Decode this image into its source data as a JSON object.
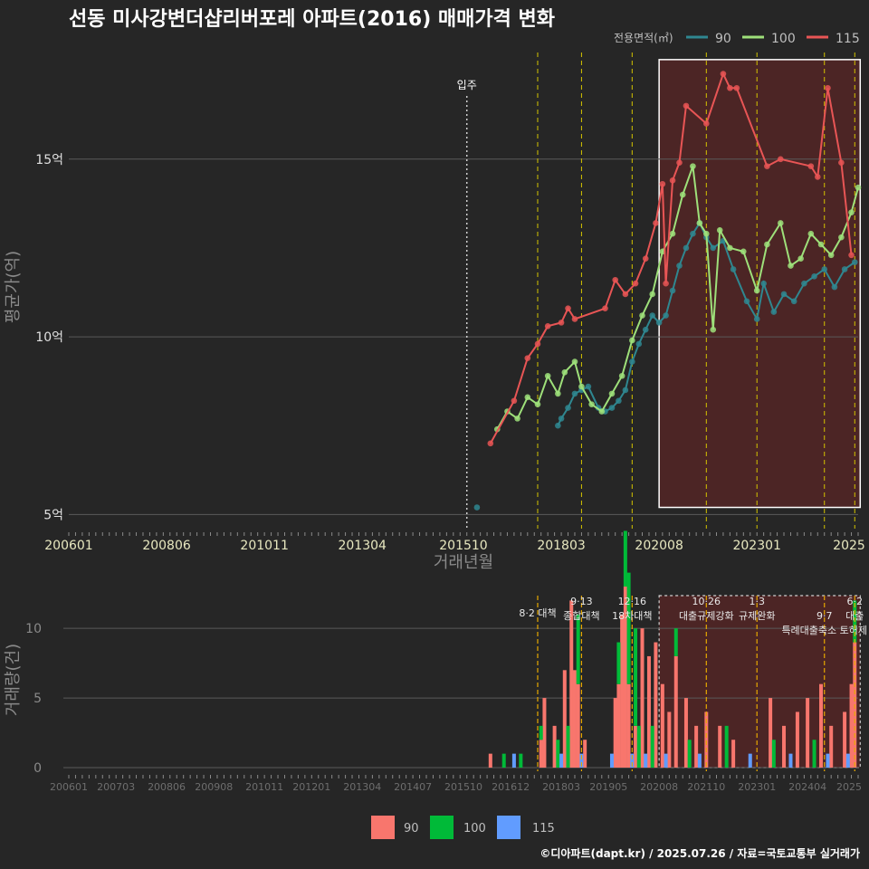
{
  "title": "선동 미사강변더샵리버포레 아파트(2016) 매매가격 변화",
  "legend_top": {
    "title": "전용면적(㎡)",
    "items": [
      "90",
      "100",
      "115"
    ]
  },
  "legend_bottom": {
    "items": [
      "90",
      "100",
      "115"
    ]
  },
  "footer": "©디아파트(dapt.kr) / 2025.07.26 / 자료=국토교통부 실거래가",
  "colors": {
    "background": "#262626",
    "price_90": "#2f8790",
    "price_100": "#9ee07a",
    "price_115": "#e85555",
    "vol_90": "#f8766d",
    "vol_100": "#00ba38",
    "vol_115": "#619cff",
    "policy_line": "#d4c400",
    "highlight_fill": "#5a2626"
  },
  "chart_data": [
    {
      "type": "line",
      "title": "선동 미사강변더샵리버포레 아파트(2016) 매매가격 변화",
      "xlabel": "거래년월",
      "ylabel": "평균가(억)",
      "x_ticks": [
        "200601",
        "200806",
        "201011",
        "201304",
        "201510",
        "201803",
        "202008",
        "202301",
        "2025"
      ],
      "y_ticks": [
        "5억",
        "10억",
        "15억"
      ],
      "ylim": [
        4.5,
        18
      ],
      "grid": true,
      "legend": "top-right",
      "annotation": "입주",
      "annotation_x": "2015-11",
      "policy_dates": [
        "2017-08",
        "2018-09",
        "2019-12",
        "2021-10",
        "2023-01",
        "2024-09",
        "2025-06"
      ],
      "highlight_range": [
        "2020-08",
        "2025-06"
      ],
      "series": [
        {
          "name": "90",
          "points": [
            [
              "2016-02",
              5.2
            ],
            [
              "2018-02",
              7.5
            ],
            [
              "2018-03",
              7.7
            ],
            [
              "2018-05",
              8.0
            ],
            [
              "2018-07",
              8.4
            ],
            [
              "2018-09",
              8.5
            ],
            [
              "2018-11",
              8.6
            ],
            [
              "2019-02",
              8.0
            ],
            [
              "2019-04",
              7.9
            ],
            [
              "2019-06",
              8.0
            ],
            [
              "2019-08",
              8.2
            ],
            [
              "2019-10",
              8.5
            ],
            [
              "2019-12",
              9.3
            ],
            [
              "2020-02",
              9.8
            ],
            [
              "2020-04",
              10.2
            ],
            [
              "2020-06",
              10.6
            ],
            [
              "2020-08",
              10.4
            ],
            [
              "2020-10",
              10.6
            ],
            [
              "2020-12",
              11.3
            ],
            [
              "2021-02",
              12.0
            ],
            [
              "2021-04",
              12.5
            ],
            [
              "2021-06",
              12.9
            ],
            [
              "2021-08",
              13.2
            ],
            [
              "2021-10",
              12.8
            ],
            [
              "2021-12",
              12.5
            ],
            [
              "2022-03",
              12.7
            ],
            [
              "2022-06",
              11.9
            ],
            [
              "2022-10",
              11.0
            ],
            [
              "2023-01",
              10.5
            ],
            [
              "2023-03",
              11.5
            ],
            [
              "2023-06",
              10.7
            ],
            [
              "2023-09",
              11.2
            ],
            [
              "2023-12",
              11.0
            ],
            [
              "2024-03",
              11.5
            ],
            [
              "2024-06",
              11.7
            ],
            [
              "2024-09",
              11.9
            ],
            [
              "2024-12",
              11.4
            ],
            [
              "2025-03",
              11.9
            ],
            [
              "2025-06",
              12.1
            ]
          ]
        },
        {
          "name": "100",
          "points": [
            [
              "2016-08",
              7.4
            ],
            [
              "2016-11",
              7.9
            ],
            [
              "2017-02",
              7.7
            ],
            [
              "2017-05",
              8.3
            ],
            [
              "2017-08",
              8.1
            ],
            [
              "2017-11",
              8.9
            ],
            [
              "2018-02",
              8.4
            ],
            [
              "2018-04",
              9.0
            ],
            [
              "2018-07",
              9.3
            ],
            [
              "2018-09",
              8.6
            ],
            [
              "2018-12",
              8.1
            ],
            [
              "2019-03",
              7.9
            ],
            [
              "2019-06",
              8.4
            ],
            [
              "2019-09",
              8.9
            ],
            [
              "2019-12",
              9.9
            ],
            [
              "2020-03",
              10.6
            ],
            [
              "2020-06",
              11.2
            ],
            [
              "2020-09",
              12.4
            ],
            [
              "2020-12",
              12.9
            ],
            [
              "2021-03",
              14.0
            ],
            [
              "2021-06",
              14.8
            ],
            [
              "2021-08",
              13.2
            ],
            [
              "2021-10",
              12.9
            ],
            [
              "2021-12",
              10.2
            ],
            [
              "2022-02",
              13.0
            ],
            [
              "2022-05",
              12.5
            ],
            [
              "2022-09",
              12.4
            ],
            [
              "2023-01",
              11.3
            ],
            [
              "2023-04",
              12.6
            ],
            [
              "2023-08",
              13.2
            ],
            [
              "2023-11",
              12.0
            ],
            [
              "2024-02",
              12.2
            ],
            [
              "2024-05",
              12.9
            ],
            [
              "2024-08",
              12.6
            ],
            [
              "2024-11",
              12.3
            ],
            [
              "2025-02",
              12.8
            ],
            [
              "2025-05",
              13.5
            ],
            [
              "2025-07",
              14.2
            ]
          ]
        },
        {
          "name": "115",
          "points": [
            [
              "2016-06",
              7.0
            ],
            [
              "2017-01",
              8.2
            ],
            [
              "2017-05",
              9.4
            ],
            [
              "2017-08",
              9.8
            ],
            [
              "2017-11",
              10.3
            ],
            [
              "2018-03",
              10.4
            ],
            [
              "2018-05",
              10.8
            ],
            [
              "2018-07",
              10.5
            ],
            [
              "2019-04",
              10.8
            ],
            [
              "2019-07",
              11.6
            ],
            [
              "2019-10",
              11.2
            ],
            [
              "2020-01",
              11.5
            ],
            [
              "2020-04",
              12.2
            ],
            [
              "2020-07",
              13.2
            ],
            [
              "2020-09",
              14.3
            ],
            [
              "2020-10",
              11.5
            ],
            [
              "2020-12",
              14.4
            ],
            [
              "2021-02",
              14.9
            ],
            [
              "2021-04",
              16.5
            ],
            [
              "2021-10",
              16.0
            ],
            [
              "2022-03",
              17.4
            ],
            [
              "2022-05",
              17.0
            ],
            [
              "2022-07",
              17.0
            ],
            [
              "2023-04",
              14.8
            ],
            [
              "2023-08",
              15.0
            ],
            [
              "2024-05",
              14.8
            ],
            [
              "2024-07",
              14.5
            ],
            [
              "2024-10",
              17.0
            ],
            [
              "2025-02",
              14.9
            ],
            [
              "2025-05",
              12.3
            ]
          ]
        }
      ]
    },
    {
      "type": "bar",
      "xlabel": "",
      "ylabel": "거래량(건)",
      "x_ticks": [
        "200601",
        "200703",
        "200806",
        "200908",
        "201011",
        "201201",
        "201304",
        "201407",
        "201510",
        "201612",
        "201803",
        "201905",
        "202008",
        "202110",
        "202301",
        "202404",
        "2025"
      ],
      "y_ticks": [
        "0",
        "5",
        "10"
      ],
      "ylim": [
        0,
        13
      ],
      "stacked": true,
      "policy_lines": [
        {
          "date": "2017-08",
          "label": "8·2 대책"
        },
        {
          "date": "2018-09",
          "label": "9·13"
        },
        {
          "date": "2018-09",
          "label": "종합대책"
        },
        {
          "date": "2019-12",
          "label": "12·16"
        },
        {
          "date": "2019-12",
          "label": "18차대책"
        },
        {
          "date": "2021-10",
          "label": "10·26"
        },
        {
          "date": "2021-10",
          "label": "대출규제강화"
        },
        {
          "date": "2023-01",
          "label": "1·3"
        },
        {
          "date": "2023-01",
          "label": "규제완화"
        },
        {
          "date": "2024-09",
          "label": "9·7"
        },
        {
          "date": "2024-09",
          "label": "특례대출축소 토허제"
        },
        {
          "date": "2025-06",
          "label": "6·2"
        },
        {
          "date": "2025-06",
          "label": "대출"
        }
      ],
      "series": [
        {
          "name": "90",
          "values": [
            [
              "2016-06",
              1
            ],
            [
              "2017-09",
              2
            ],
            [
              "2017-10",
              5
            ],
            [
              "2018-01",
              3
            ],
            [
              "2018-04",
              7
            ],
            [
              "2018-06",
              12
            ],
            [
              "2018-07",
              7
            ],
            [
              "2018-08",
              6
            ],
            [
              "2018-10",
              2
            ],
            [
              "2019-07",
              5
            ],
            [
              "2019-08",
              6
            ],
            [
              "2019-09",
              11
            ],
            [
              "2019-10",
              13
            ],
            [
              "2019-11",
              6
            ],
            [
              "2020-01",
              3
            ],
            [
              "2020-03",
              10
            ],
            [
              "2020-05",
              8
            ],
            [
              "2020-07",
              9
            ],
            [
              "2020-09",
              6
            ],
            [
              "2020-11",
              4
            ],
            [
              "2021-01",
              8
            ],
            [
              "2021-04",
              5
            ],
            [
              "2021-07",
              3
            ],
            [
              "2021-10",
              4
            ],
            [
              "2022-02",
              3
            ],
            [
              "2022-06",
              2
            ],
            [
              "2023-05",
              5
            ],
            [
              "2023-09",
              3
            ],
            [
              "2024-01",
              4
            ],
            [
              "2024-04",
              5
            ],
            [
              "2024-08",
              6
            ],
            [
              "2024-11",
              3
            ],
            [
              "2025-03",
              4
            ],
            [
              "2025-05",
              6
            ],
            [
              "2025-06",
              9
            ]
          ]
        },
        {
          "name": "100",
          "values": [
            [
              "2016-10",
              1
            ],
            [
              "2017-03",
              1
            ],
            [
              "2017-09",
              1
            ],
            [
              "2018-02",
              2
            ],
            [
              "2018-05",
              3
            ],
            [
              "2018-08",
              5
            ],
            [
              "2019-08",
              3
            ],
            [
              "2019-10",
              4
            ],
            [
              "2019-11",
              8
            ],
            [
              "2020-01",
              7
            ],
            [
              "2020-02",
              3
            ],
            [
              "2020-06",
              3
            ],
            [
              "2021-01",
              2
            ],
            [
              "2021-05",
              2
            ],
            [
              "2022-04",
              3
            ],
            [
              "2023-06",
              2
            ],
            [
              "2024-06",
              2
            ],
            [
              "2025-06",
              3
            ]
          ]
        },
        {
          "name": "115",
          "values": [
            [
              "2017-01",
              1
            ],
            [
              "2018-03",
              1
            ],
            [
              "2018-09",
              1
            ],
            [
              "2019-06",
              1
            ],
            [
              "2019-12",
              1
            ],
            [
              "2020-04",
              1
            ],
            [
              "2020-10",
              1
            ],
            [
              "2021-08",
              1
            ],
            [
              "2022-11",
              1
            ],
            [
              "2023-11",
              1
            ],
            [
              "2024-10",
              1
            ],
            [
              "2025-04",
              1
            ]
          ]
        }
      ]
    }
  ]
}
